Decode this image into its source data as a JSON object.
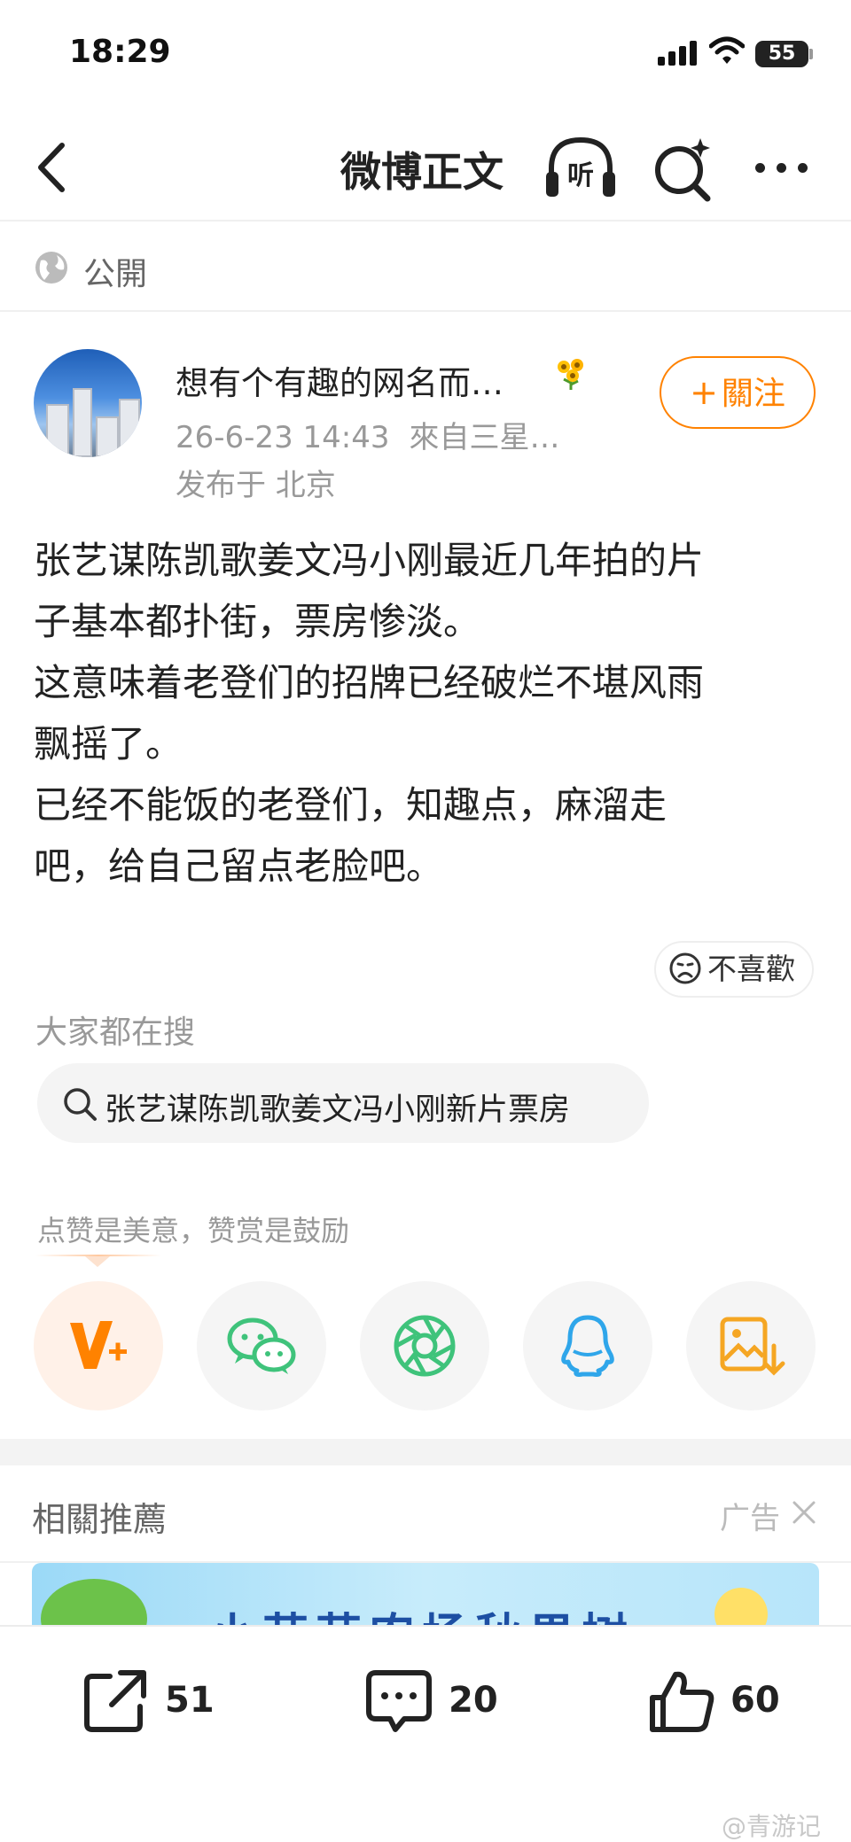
{
  "status_bar": {
    "time": "18:29",
    "battery": "55"
  },
  "navbar": {
    "title": "微博正文",
    "listen_label": "听"
  },
  "visibility": {
    "label": "公開"
  },
  "author": {
    "name": "想有个有趣的网名而…",
    "date": "26-6-23 14:43",
    "source": "來自三星…",
    "location": "发布于 北京",
    "follow_label": "關注"
  },
  "post": {
    "lines": [
      "张艺谋陈凯歌姜文冯小刚最近几年拍的片",
      "子基本都扑街，票房惨淡。",
      "这意味着老登们的招牌已经破烂不堪风雨",
      "飘摇了。",
      "已经不能饭的老登们，知趣点，麻溜走",
      "吧，给自己留点老脸吧。"
    ]
  },
  "dislike": {
    "label": "不喜歡"
  },
  "hot_search": {
    "label": "大家都在搜",
    "query": "张艺谋陈凯歌姜文冯小刚新片票房"
  },
  "share": {
    "hint": "点赞是美意，赞赏是鼓励",
    "icons": [
      "v-plus-icon",
      "wechat-icon",
      "moments-icon",
      "qq-icon",
      "save-image-icon"
    ],
    "colors": {
      "orange": "#ff8200",
      "green": "#3fc37b",
      "blue": "#2fa6ea",
      "gold": "#f5a623"
    }
  },
  "related": {
    "title": "相關推薦",
    "ad_label": "广告",
    "ad_text": "小芭芭农场秋果树"
  },
  "actions": {
    "repost_count": "51",
    "comment_count": "20",
    "like_count": "60"
  },
  "watermark": "@青游记"
}
